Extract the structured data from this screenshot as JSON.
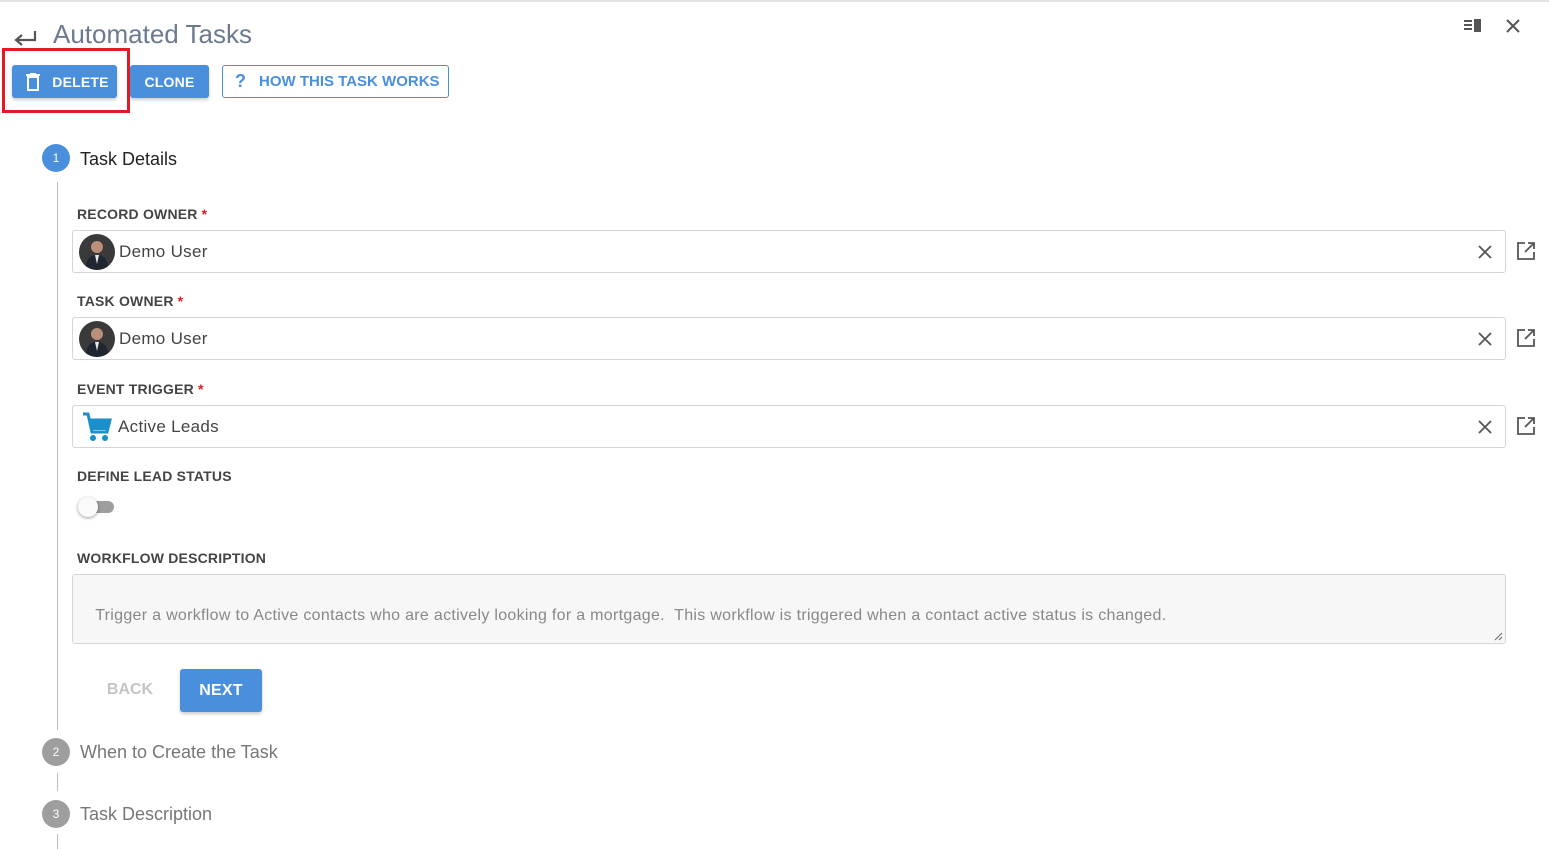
{
  "header": {
    "title": "Automated Tasks"
  },
  "toolbar": {
    "delete_label": "DELETE",
    "clone_label": "CLONE",
    "help_icon": "?",
    "help_label": "HOW THIS TASK WORKS"
  },
  "steps": [
    {
      "number": "1",
      "label": "Task Details",
      "active": true
    },
    {
      "number": "2",
      "label": "When to Create the Task",
      "active": false
    },
    {
      "number": "3",
      "label": "Task Description",
      "active": false
    }
  ],
  "form": {
    "record_owner": {
      "label": "RECORD OWNER",
      "required": "*",
      "value": "Demo User"
    },
    "task_owner": {
      "label": "TASK OWNER",
      "required": "*",
      "value": "Demo User"
    },
    "event_trigger": {
      "label": "EVENT TRIGGER",
      "required": "*",
      "value": "Active Leads",
      "icon": "cart-icon"
    },
    "define_lead_status": {
      "label": "DEFINE LEAD STATUS",
      "enabled": false
    },
    "workflow_description": {
      "label": "WORKFLOW DESCRIPTION",
      "value": "Trigger a workflow to Active contacts who are actively looking for a mortgage.  This workflow is triggered when a contact active status is changed."
    }
  },
  "nav": {
    "back_label": "BACK",
    "next_label": "NEXT"
  },
  "colors": {
    "primary": "#4a8fdb",
    "highlight": "#e01b24",
    "required": "#e01b24",
    "cart": "#1a8fc9"
  }
}
